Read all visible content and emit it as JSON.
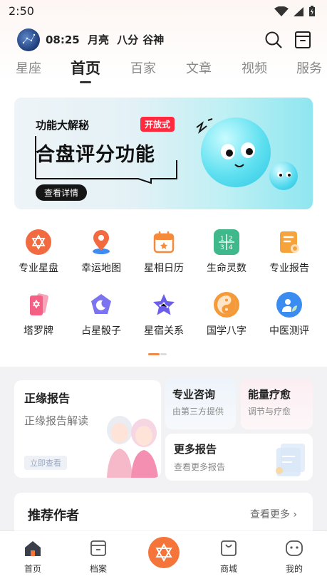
{
  "status_bar": {
    "time": "2:50"
  },
  "header": {
    "time": "08:25",
    "moon": "月亮",
    "phase": "八分",
    "deity": "谷神",
    "icons": [
      "search-icon",
      "archive-icon"
    ]
  },
  "tabs": [
    {
      "label": "星座"
    },
    {
      "label": "首页",
      "active": true
    },
    {
      "label": "百家"
    },
    {
      "label": "文章"
    },
    {
      "label": "视频"
    },
    {
      "label": "服务"
    }
  ],
  "banner": {
    "small_title": "功能大解秘",
    "big_title": "合盘评分功能",
    "tag": "开放式",
    "button": "查看详情"
  },
  "grid": [
    {
      "label": "专业星盘",
      "icon": "star-of-david-icon",
      "color": "#f26a3f"
    },
    {
      "label": "幸运地图",
      "icon": "map-pin-icon",
      "color": "#f26a3f"
    },
    {
      "label": "星相日历",
      "icon": "calendar-icon",
      "color": "#f58a3a"
    },
    {
      "label": "生命灵数",
      "icon": "numbers-grid-icon",
      "color": "#3fb98b"
    },
    {
      "label": "专业报告",
      "icon": "report-icon",
      "color": "#f5a33a"
    },
    {
      "label": "塔罗牌",
      "icon": "tarot-cards-icon",
      "color": "#f55f84"
    },
    {
      "label": "占星骰子",
      "icon": "dice-moon-icon",
      "color": "#7b73f0"
    },
    {
      "label": "星宿关系",
      "icon": "star-constellation-icon",
      "color": "#6b5ee8"
    },
    {
      "label": "国学八字",
      "icon": "yin-yang-icon",
      "color": "#f59a3a"
    },
    {
      "label": "中医测评",
      "icon": "leaf-person-icon",
      "color": "#3b8cf0"
    }
  ],
  "cards": {
    "zhengyuan": {
      "title": "正缘报告",
      "subtitle": "正缘报告解读",
      "button": "立即查看"
    },
    "consult": {
      "title": "专业咨询",
      "subtitle": "由第三方提供"
    },
    "energy": {
      "title": "能量疗愈",
      "subtitle": "调节与疗愈"
    },
    "more": {
      "title": "更多报告",
      "subtitle": "查看更多报告"
    }
  },
  "authors": {
    "title": "推荐作者",
    "more": "查看更多 ›"
  },
  "bottom_nav": [
    {
      "label": "首页",
      "icon": "home-icon",
      "active": true
    },
    {
      "label": "档案",
      "icon": "archive-icon"
    },
    {
      "label": "",
      "icon": "star-of-david-icon"
    },
    {
      "label": "商城",
      "icon": "shopping-bag-icon"
    },
    {
      "label": "我的",
      "icon": "profile-icon"
    }
  ],
  "colors": {
    "accent": "#f5743a",
    "text": "#222222",
    "muted": "#888888"
  }
}
